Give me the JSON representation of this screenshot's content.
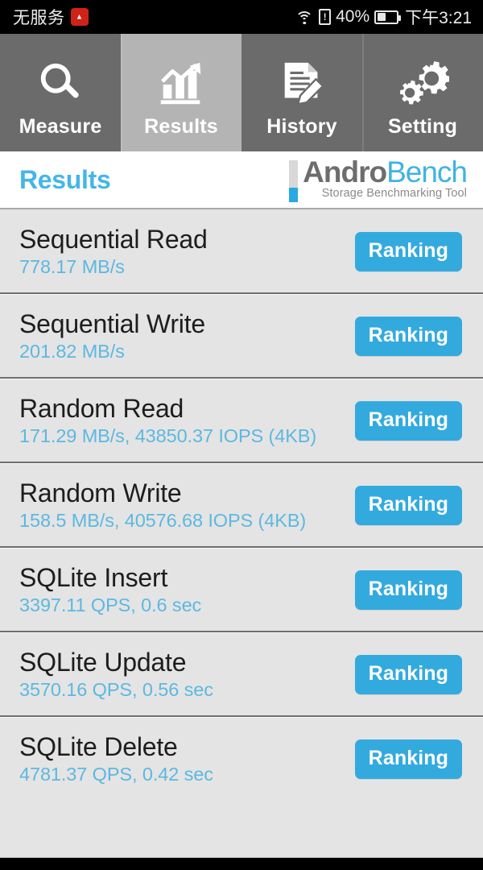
{
  "statusbar": {
    "carrier": "无服务",
    "app_badge_icon": "red-app-icon",
    "wifi_icon": "wifi-icon",
    "sim_icon": "sim-alert-icon",
    "battery_percent": "40%",
    "battery_icon": "battery-icon",
    "time": "下午3:21"
  },
  "tabs": [
    {
      "label": "Measure",
      "icon": "magnifier-icon",
      "active": false
    },
    {
      "label": "Results",
      "icon": "bar-chart-icon",
      "active": true
    },
    {
      "label": "History",
      "icon": "document-pencil-icon",
      "active": false
    },
    {
      "label": "Setting",
      "icon": "gears-icon",
      "active": false
    }
  ],
  "header": {
    "title": "Results",
    "brand_name_part1": "Andro",
    "brand_name_part2": "Bench",
    "brand_tagline": "Storage Benchmarking Tool"
  },
  "colors": {
    "accent_blue": "#33aade",
    "title_blue": "#44b6e8",
    "value_blue": "#5db8e0",
    "tabbar_bg": "#6b6b6b",
    "tab_active_bg": "#b4b4b4",
    "list_bg": "#e4e4e4",
    "brand_gray": "#6d6d6d",
    "brand_blue": "#3fb3e3"
  },
  "results": [
    {
      "title": "Sequential Read",
      "value": "778.17 MB/s",
      "button": "Ranking"
    },
    {
      "title": "Sequential Write",
      "value": "201.82 MB/s",
      "button": "Ranking"
    },
    {
      "title": "Random Read",
      "value": "171.29 MB/s, 43850.37 IOPS (4KB)",
      "button": "Ranking"
    },
    {
      "title": "Random Write",
      "value": "158.5 MB/s, 40576.68 IOPS (4KB)",
      "button": "Ranking"
    },
    {
      "title": "SQLite Insert",
      "value": "3397.11 QPS, 0.6 sec",
      "button": "Ranking"
    },
    {
      "title": "SQLite Update",
      "value": "3570.16 QPS, 0.56 sec",
      "button": "Ranking"
    },
    {
      "title": "SQLite Delete",
      "value": "4781.37 QPS, 0.42 sec",
      "button": "Ranking"
    }
  ]
}
